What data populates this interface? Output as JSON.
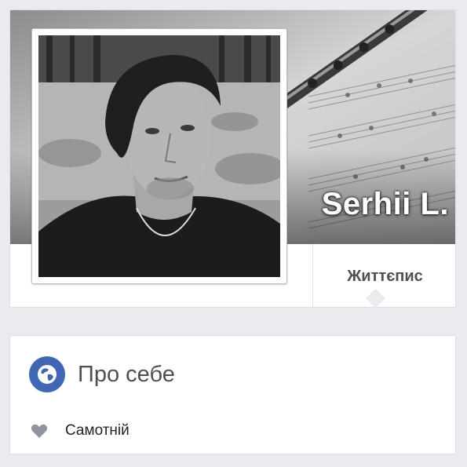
{
  "profile": {
    "name": "Serhii L."
  },
  "tabs": {
    "timeline_label": "Життєпис"
  },
  "about": {
    "title": "Про себе",
    "title_icon": "globe-icon",
    "relationship_icon": "heart-icon",
    "relationship": "Самотній"
  },
  "colors": {
    "accent": "#4267b2",
    "page_bg": "#e9ebee",
    "card_border": "#dddfe2",
    "heart": "#90949c"
  }
}
